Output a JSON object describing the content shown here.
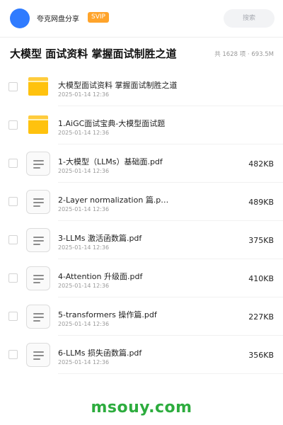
{
  "header": {
    "app_name": "夸克网盘分享",
    "badge": "SVIP",
    "search_placeholder": "搜索"
  },
  "folder": {
    "title": "大模型 面试资料 掌握面试制胜之道",
    "summary": "共 1628 项 · 693.5M"
  },
  "files": [
    {
      "name": "大模型面试资料 掌握面试制胜之道",
      "date": "2025-01-14 12:36",
      "size": "",
      "type": "folder",
      "icon": "folder-icon"
    },
    {
      "name": "1.AiGC面试宝典-大模型面试题",
      "date": "2025-01-14 12:36",
      "size": "",
      "type": "folder",
      "icon": "folder-icon"
    },
    {
      "name": "1-大模型（LLMs）基础面.pdf",
      "date": "2025-01-14 12:36",
      "size": "482KB",
      "type": "file",
      "icon": "document-icon"
    },
    {
      "name": "2-Layer normalization 篇.p…",
      "date": "2025-01-14 12:36",
      "size": "489KB",
      "type": "file",
      "icon": "document-icon"
    },
    {
      "name": "3-LLMs 激活函数篇.pdf",
      "date": "2025-01-14 12:36",
      "size": "375KB",
      "type": "file",
      "icon": "document-icon"
    },
    {
      "name": "4-Attention 升级面.pdf",
      "date": "2025-01-14 12:36",
      "size": "410KB",
      "type": "file",
      "icon": "document-icon"
    },
    {
      "name": "5-transformers 操作篇.pdf",
      "date": "2025-01-14 12:36",
      "size": "227KB",
      "type": "file",
      "icon": "document-icon"
    },
    {
      "name": "6-LLMs 损失函数篇.pdf",
      "date": "2025-01-14 12:36",
      "size": "356KB",
      "type": "file",
      "icon": "document-icon"
    }
  ],
  "watermark": "msouy.com",
  "colors": {
    "accent": "#2f7bff",
    "badge": "#ffa42b",
    "folder": "#ffc20e",
    "watermark": "#2dac3e"
  }
}
